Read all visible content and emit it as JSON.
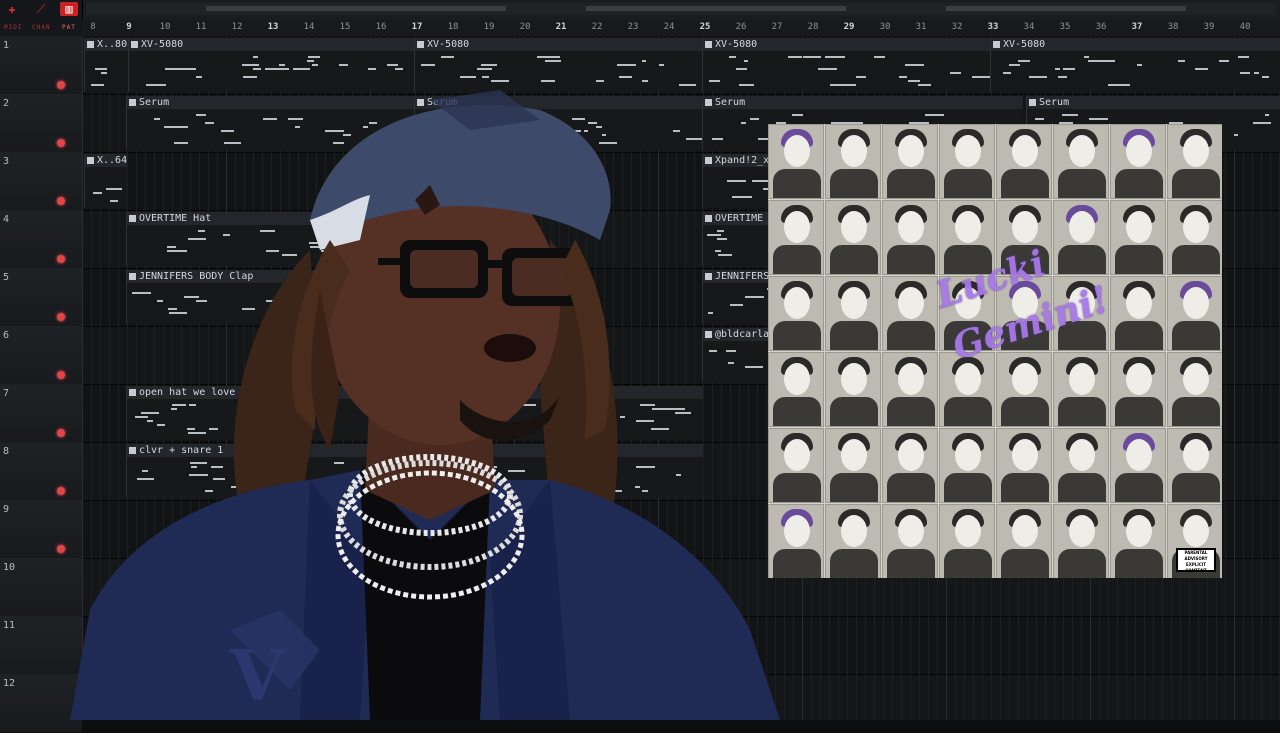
{
  "mode_buttons": [
    {
      "label": "MIDI",
      "icon": "keyboard-icon"
    },
    {
      "label": "CHAN",
      "icon": "wave-icon"
    },
    {
      "label": "PAT",
      "icon": "pattern-icon"
    }
  ],
  "ruler": {
    "bars": [
      "8",
      "9",
      "10",
      "11",
      "12",
      "13",
      "14",
      "15",
      "16",
      "17",
      "18",
      "19",
      "20",
      "21",
      "22",
      "23",
      "24",
      "25",
      "26",
      "27",
      "28",
      "29",
      "30",
      "31",
      "32",
      "33",
      "34",
      "35",
      "36",
      "37",
      "38",
      "39",
      "40"
    ],
    "major_bars": [
      "9",
      "13",
      "17",
      "21",
      "25",
      "29",
      "33",
      "37"
    ]
  },
  "tracks": [
    {
      "number": "1"
    },
    {
      "number": "2"
    },
    {
      "number": "3"
    },
    {
      "number": "4"
    },
    {
      "number": "5"
    },
    {
      "number": "6"
    },
    {
      "number": "7"
    },
    {
      "number": "8"
    },
    {
      "number": "9"
    },
    {
      "number": "10"
    },
    {
      "number": "11"
    },
    {
      "number": "12"
    }
  ],
  "clips": {
    "t1_a": "X..80",
    "t1_b": "XV-5080",
    "t1_c": "XV-5080",
    "t1_d": "XV-5080",
    "t1_e": "XV-5080",
    "t2_a": "Serum",
    "t2_b": "Serum",
    "t2_c": "Serum",
    "t2_d": "Serum",
    "t3_a": "X..64",
    "t3_b": "Xpand!2_x",
    "t4_a": "OVERTIME Hat",
    "t4_b": "OVERTIME",
    "t5_a": "JENNIFERS BODY Clap",
    "t5_b": "JENNIFERS",
    "t6_a": "@bldcarla",
    "t7_a": "open hat we love",
    "t8_a": "clvr + snare 1"
  },
  "album_cover": {
    "script_line1": "Lucki",
    "script_line2": "Gemini!",
    "advisory": "PARENTAL ADVISORY EXPLICIT CONTENT"
  },
  "colors": {
    "accent_red": "#e0454a",
    "cover_purple": "#a778e8",
    "jacket_navy": "#1f2a55"
  }
}
